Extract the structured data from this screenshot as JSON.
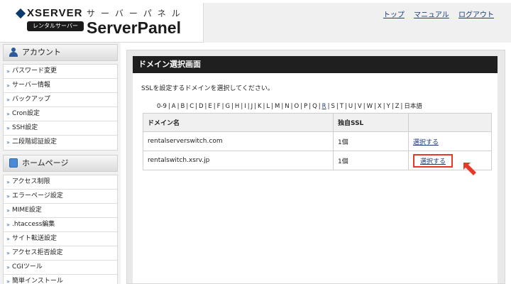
{
  "header": {
    "brand": "XSERVER",
    "brand_badge": "レンタルサーバー",
    "product_kana": "サーバーパネル",
    "product_title": "ServerPanel",
    "links": [
      {
        "label": "トップ"
      },
      {
        "label": "マニュアル"
      },
      {
        "label": "ログアウト"
      }
    ]
  },
  "sidebar": {
    "sections": [
      {
        "title": "アカウント",
        "icon": "user-icon",
        "items": [
          {
            "label": "パスワード変更"
          },
          {
            "label": "サーバー情報"
          },
          {
            "label": "バックアップ"
          },
          {
            "label": "Cron設定"
          },
          {
            "label": "SSH設定"
          },
          {
            "label": "二段階認証設定"
          }
        ]
      },
      {
        "title": "ホームページ",
        "icon": "homepage-icon",
        "items": [
          {
            "label": "アクセス制限"
          },
          {
            "label": "エラーページ設定"
          },
          {
            "label": "MIME設定"
          },
          {
            "label": ".htaccess編集"
          },
          {
            "label": "サイト転送設定"
          },
          {
            "label": "アクセス拒否設定"
          },
          {
            "label": "CGIツール"
          },
          {
            "label": "簡単インストール"
          }
        ]
      }
    ]
  },
  "main": {
    "title": "ドメイン選択画面",
    "instruction": "SSLを設定するドメインを選択してください。",
    "alpha_nav": [
      "0-9",
      "A",
      "B",
      "C",
      "D",
      "E",
      "F",
      "G",
      "H",
      "I",
      "J",
      "K",
      "L",
      "M",
      "N",
      "O",
      "P",
      "Q",
      "R",
      "S",
      "T",
      "U",
      "V",
      "W",
      "X",
      "Y",
      "Z",
      "日本語"
    ],
    "alpha_nav_linked": "R",
    "table": {
      "headers": [
        "ドメイン名",
        "独自SSL",
        ""
      ],
      "rows": [
        {
          "domain": "rentalserverswitch.com",
          "ssl": "1個",
          "action": "選択する",
          "highlighted": false
        },
        {
          "domain": "rentalswitch.xsrv.jp",
          "ssl": "1個",
          "action": "選択する",
          "highlighted": true
        }
      ]
    }
  },
  "colors": {
    "panel_header_bg": "#1f1f1f",
    "link": "#1a3b7a",
    "highlight": "#e53a2a"
  }
}
